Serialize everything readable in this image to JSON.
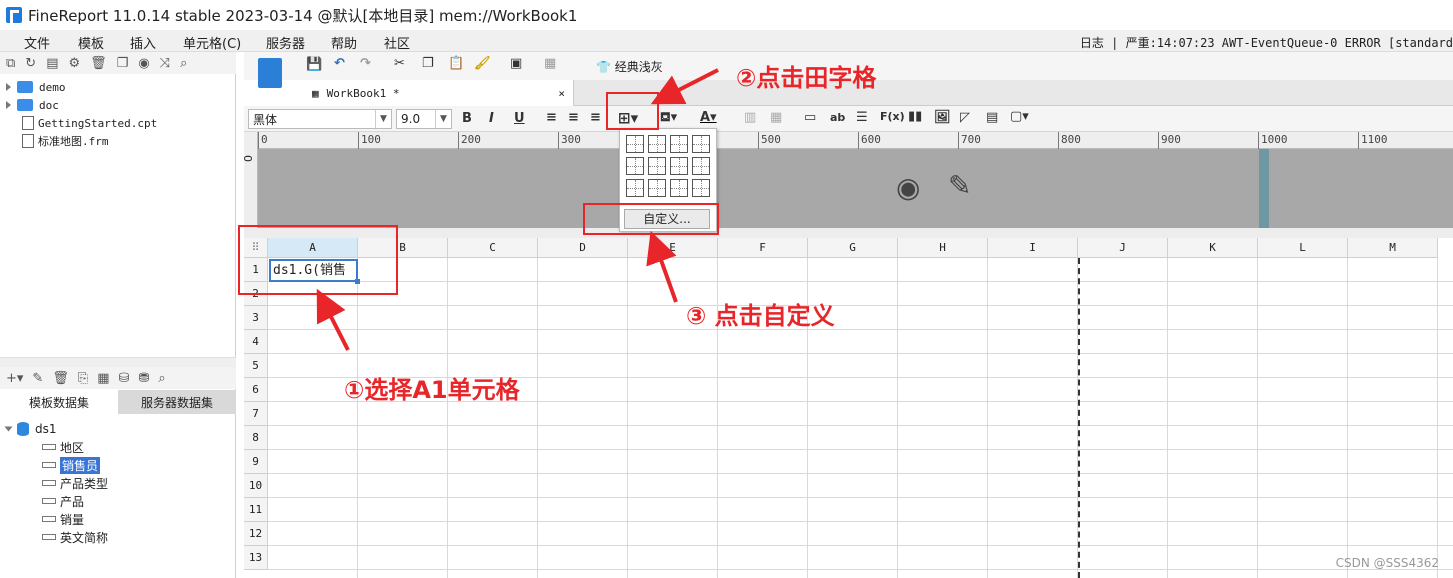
{
  "window": {
    "title": "FineReport 11.0.14 stable 2023-03-14 @默认[本地目录]    mem://WorkBook1"
  },
  "menu": {
    "items": [
      "文件",
      "模板",
      "插入",
      "单元格(C)",
      "服务器",
      "帮助",
      "社区"
    ],
    "log": "日志 | 严重:14:07:23 AWT-EventQueue-0 ERROR [standard"
  },
  "file_tree": [
    {
      "label": "demo",
      "type": "folder"
    },
    {
      "label": "doc",
      "type": "folder"
    },
    {
      "label": "GettingStarted.cpt",
      "type": "file"
    },
    {
      "label": "标准地图.frm",
      "type": "file"
    }
  ],
  "dataset_tabs": {
    "template": "模板数据集",
    "server": "服务器数据集"
  },
  "dataset": {
    "name": "ds1",
    "fields": [
      "地区",
      "销售员",
      "产品类型",
      "产品",
      "销量",
      "英文简称"
    ],
    "selected": "销售员"
  },
  "toolbar": {
    "theme_label": "经典浅灰",
    "font": "黑体",
    "font_size": "9.0",
    "bold": "B",
    "italic": "I",
    "underline": "U"
  },
  "doc_tab": {
    "label": "WorkBook1 *",
    "close": "×"
  },
  "ruler": {
    "labels": [
      "0",
      "100",
      "200",
      "300",
      "400",
      "500",
      "600",
      "700",
      "800",
      "900",
      "1000",
      "1100"
    ],
    "vertical": "0"
  },
  "grid": {
    "columns": [
      "A",
      "B",
      "C",
      "D",
      "E",
      "F",
      "G",
      "H",
      "I",
      "J",
      "K",
      "L",
      "M"
    ],
    "rows": [
      "1",
      "2",
      "3",
      "4",
      "5",
      "6",
      "7",
      "8",
      "9",
      "10",
      "11",
      "12",
      "13"
    ],
    "a1_value": "ds1.G(销售"
  },
  "border_popup": {
    "custom_label": "自定义..."
  },
  "annotations": {
    "step1": "①选择A1单元格",
    "step2": "②点击田字格",
    "step3": "③ 点击自定义"
  },
  "watermark": "CSDN @SSS4362",
  "colors": {
    "annotation": "#e8262a",
    "selection": "#3d7cc9",
    "header_area": "#a8a8a8"
  }
}
